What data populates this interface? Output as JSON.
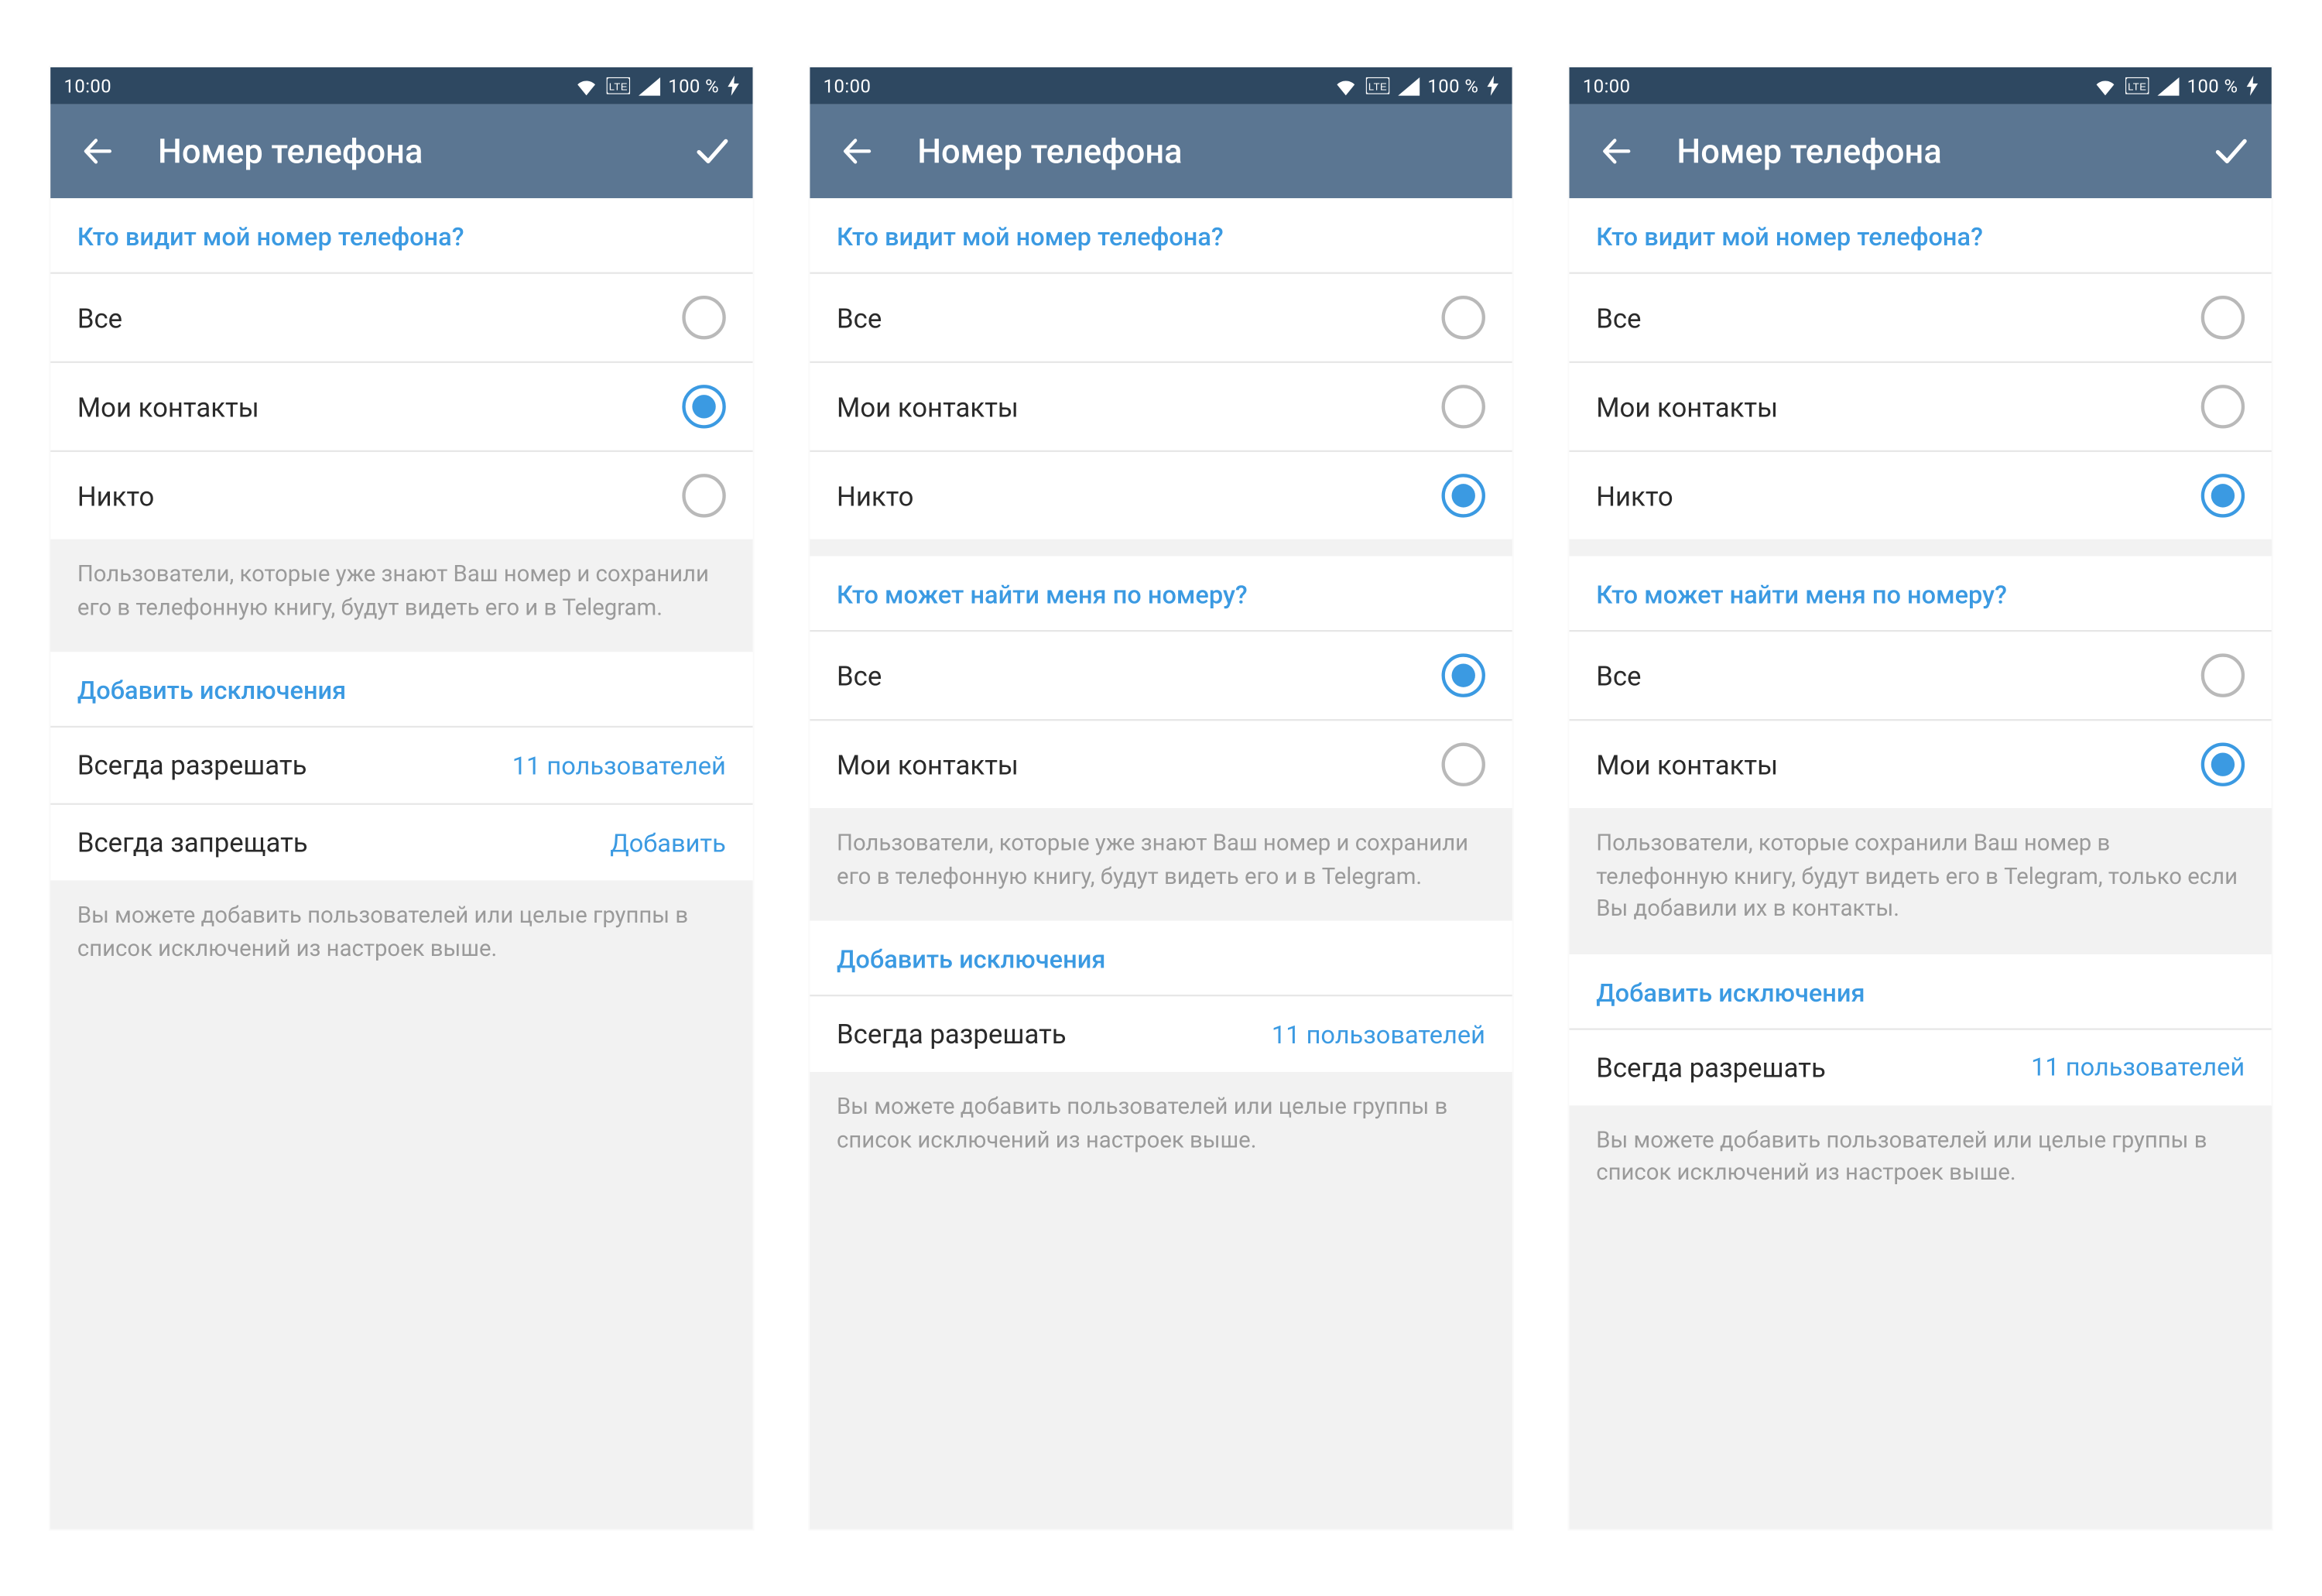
{
  "status": {
    "time": "10:00",
    "battery": "100 %"
  },
  "appbar": {
    "title": "Номер телефона"
  },
  "screens": [
    {
      "show_check": true,
      "sections": [
        {
          "header": "Кто видит мой номер телефона?",
          "type": "radio",
          "selected": 1,
          "items": [
            "Все",
            "Мои контакты",
            "Никто"
          ]
        }
      ],
      "note_after_first": "Пользователи, которые уже знают Ваш номер и сохранили его в телефонную книгу, будут видеть его и в Telegram.",
      "exceptions": {
        "header": "Добавить исключения",
        "rows": [
          {
            "label": "Всегда разрешать",
            "value": "11 пользователей"
          },
          {
            "label": "Всегда запрещать",
            "value": "Добавить"
          }
        ]
      },
      "bottom_note": "Вы можете добавить пользователей или целые группы в список исключений из настроек выше."
    },
    {
      "show_check": false,
      "sections": [
        {
          "header": "Кто видит мой номер телефона?",
          "type": "radio",
          "selected": 2,
          "items": [
            "Все",
            "Мои контакты",
            "Никто"
          ]
        },
        {
          "header": "Кто может найти меня по номеру?",
          "type": "radio",
          "selected": 0,
          "items": [
            "Все",
            "Мои контакты"
          ]
        }
      ],
      "note_after_second": "Пользователи, которые уже знают Ваш номер и сохранили его в телефонную книгу, будут видеть его и в Telegram.",
      "exceptions": {
        "header": "Добавить исключения",
        "rows": [
          {
            "label": "Всегда разрешать",
            "value": "11 пользователей"
          }
        ]
      },
      "bottom_note": "Вы можете добавить пользователей или целые группы в список исключений из настроек выше."
    },
    {
      "show_check": true,
      "sections": [
        {
          "header": "Кто видит мой номер телефона?",
          "type": "radio",
          "selected": 2,
          "items": [
            "Все",
            "Мои контакты",
            "Никто"
          ]
        },
        {
          "header": "Кто может найти меня по номеру?",
          "type": "radio",
          "selected": 1,
          "items": [
            "Все",
            "Мои контакты"
          ]
        }
      ],
      "note_after_second": "Пользователи, которые сохранили Ваш номер в телефонную книгу, будут видеть его в Telegram, только если Вы добавили их в контакты.",
      "exceptions": {
        "header": "Добавить исключения",
        "rows": [
          {
            "label": "Всегда разрешать",
            "value": "11 пользователей"
          }
        ]
      },
      "bottom_note": "Вы можете добавить пользователей или целые группы в список исключений из настроек выше."
    }
  ]
}
